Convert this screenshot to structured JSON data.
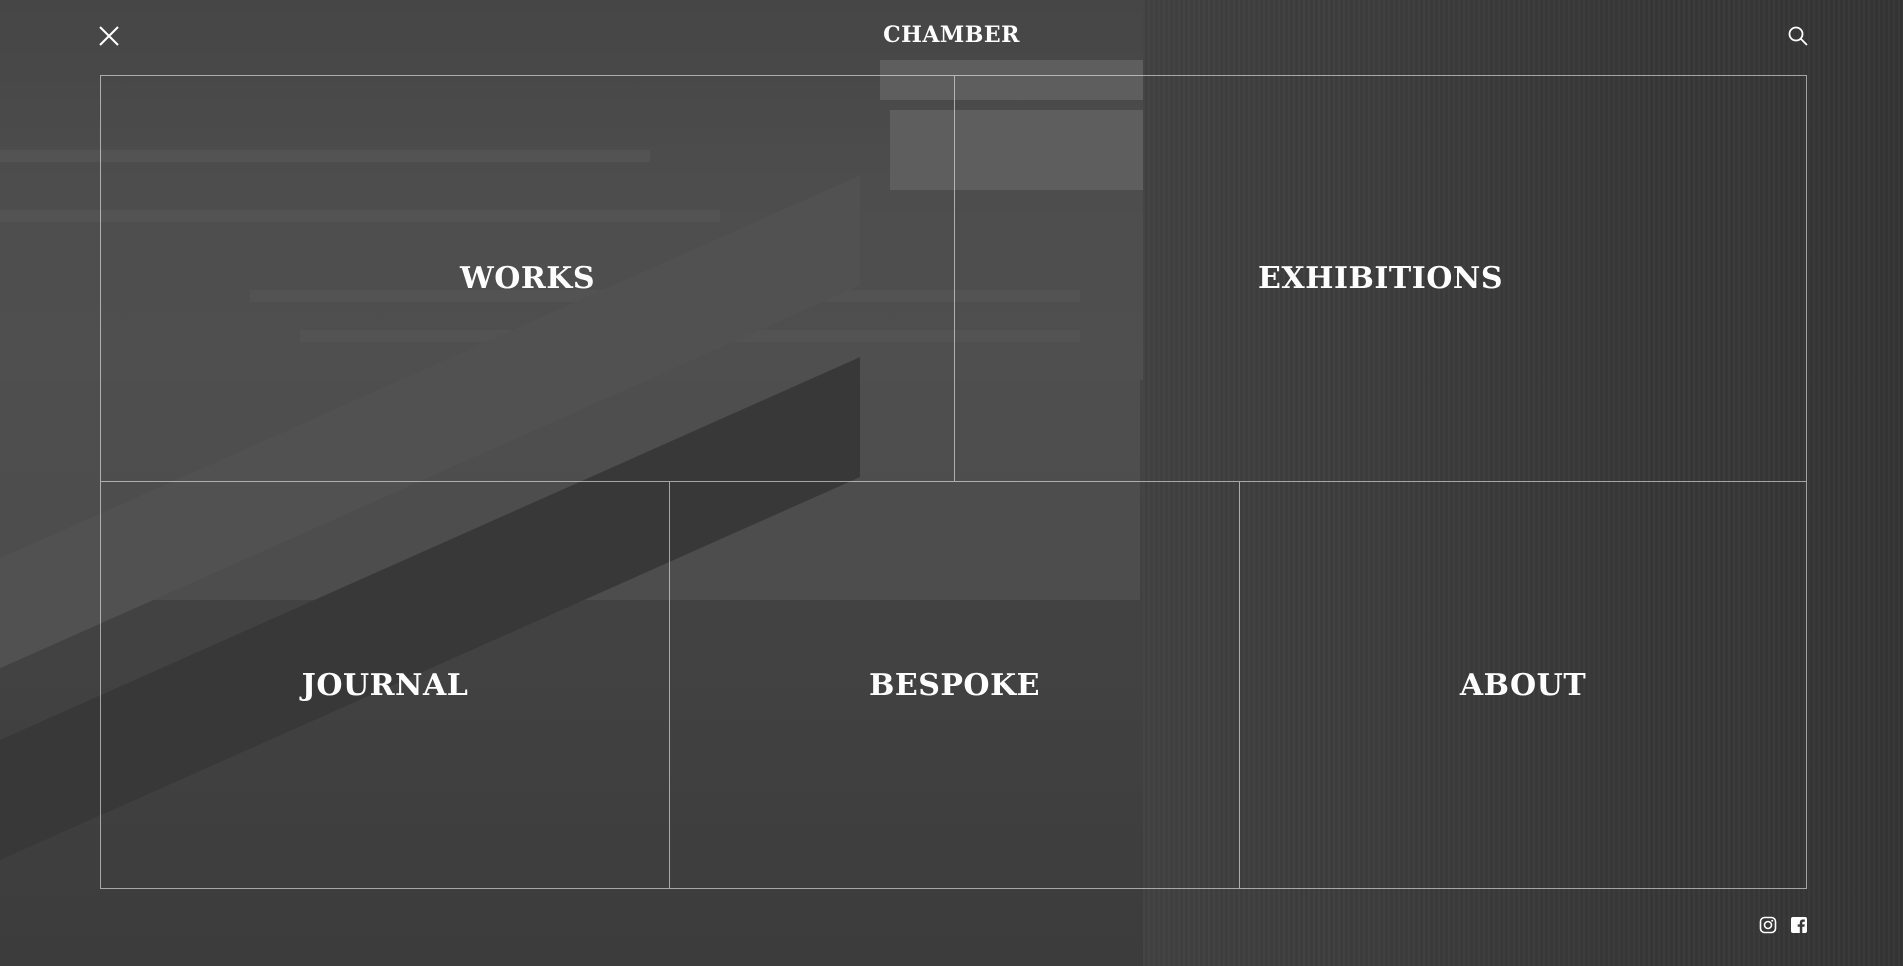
{
  "header": {
    "brand": "CHAMBER",
    "close_icon": "close-icon",
    "search_icon": "search-icon"
  },
  "menu": {
    "items": [
      {
        "label": "WORKS"
      },
      {
        "label": "EXHIBITIONS"
      },
      {
        "label": "JOURNAL"
      },
      {
        "label": "BESPOKE"
      },
      {
        "label": "ABOUT"
      }
    ]
  },
  "social": {
    "icons": [
      "instagram-icon",
      "facebook-icon"
    ]
  },
  "colors": {
    "text": "#ffffff",
    "grid_line": "rgba(255,255,255,0.55)",
    "overlay": "#3a3938"
  }
}
